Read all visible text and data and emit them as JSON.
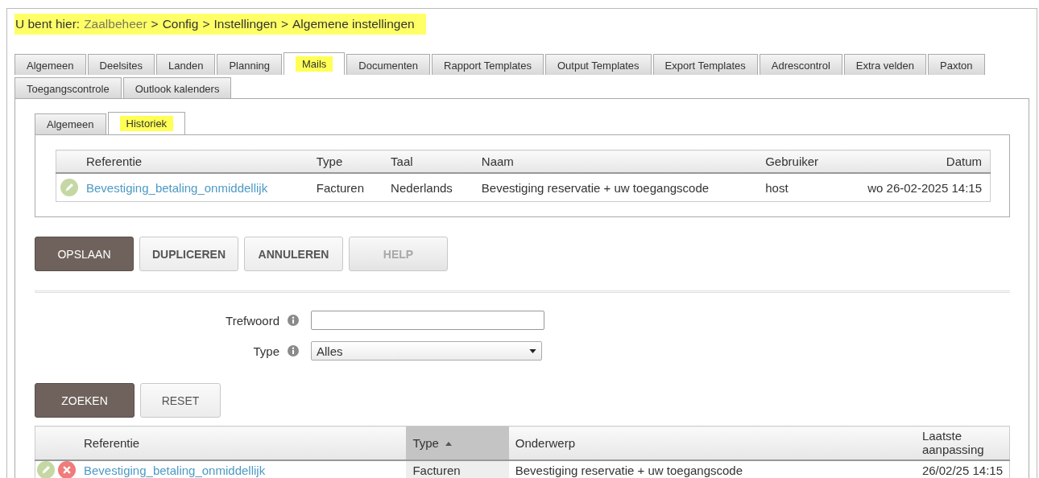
{
  "breadcrumb": {
    "label": "U bent hier:",
    "separator": ">",
    "highlighted": true,
    "items": [
      {
        "text": "Zaalbeheer",
        "link": true
      },
      {
        "text": "Config",
        "link": false
      },
      {
        "text": "Instellingen",
        "link": false
      },
      {
        "text": "Algemene instellingen",
        "link": false
      }
    ]
  },
  "tab_rows": [
    [
      {
        "label": "Algemeen",
        "selected": false
      },
      {
        "label": "Deelsites",
        "selected": false
      },
      {
        "label": "Landen",
        "selected": false
      },
      {
        "label": "Planning",
        "selected": false
      },
      {
        "label": "Mails",
        "selected": true
      },
      {
        "label": "Documenten",
        "selected": false
      },
      {
        "label": "Rapport Templates",
        "selected": false
      },
      {
        "label": "Output Templates",
        "selected": false
      },
      {
        "label": "Export Templates",
        "selected": false
      },
      {
        "label": "Adrescontrol",
        "selected": false
      },
      {
        "label": "Extra velden",
        "selected": false
      },
      {
        "label": "Paxton",
        "selected": false
      }
    ],
    [
      {
        "label": "Toegangscontrole",
        "selected": false
      },
      {
        "label": "Outlook kalenders",
        "selected": false
      }
    ]
  ],
  "subtabs": [
    {
      "label": "Algemeen",
      "selected": false
    },
    {
      "label": "Historiek",
      "selected": true
    }
  ],
  "history_table": {
    "columns": [
      "Referentie",
      "Type",
      "Taal",
      "Naam",
      "Gebruiker",
      "Datum"
    ],
    "rows": [
      {
        "cells": [
          "Bevestiging_betaling_onmiddellijk",
          "Facturen",
          "Nederlands",
          "Bevestiging reservatie + uw toegangscode",
          "host",
          "wo 26-02-2025 14:15"
        ]
      }
    ]
  },
  "buttons": [
    {
      "label": "OPSLAAN",
      "kind": "primary",
      "disabled": false
    },
    {
      "label": "DUPLICEREN",
      "kind": "default",
      "disabled": false
    },
    {
      "label": "ANNULEREN",
      "kind": "default",
      "disabled": false
    },
    {
      "label": "HELP",
      "kind": "default",
      "disabled": true
    }
  ],
  "filters": [
    {
      "label": "Trefwoord",
      "kind": "text"
    },
    {
      "label": "Type",
      "kind": "select",
      "value": "Alles"
    }
  ],
  "search_buttons": [
    {
      "label": "ZOEKEN",
      "kind": "primary"
    },
    {
      "label": "RESET",
      "kind": "default"
    }
  ],
  "results_table": {
    "columns": [
      {
        "label": "Referentie",
        "sorted": false
      },
      {
        "label": "Type",
        "sorted": true
      },
      {
        "label": "Onderwerp",
        "sorted": false
      },
      {
        "label": "Laatste aanpassing",
        "sorted": false
      }
    ],
    "rows": [
      {
        "cells": [
          "Bevestiging_betaling_onmiddellijk",
          "Facturen",
          "Bevestiging reservatie + uw toegangscode",
          "26/02/25 14:15"
        ]
      }
    ]
  }
}
